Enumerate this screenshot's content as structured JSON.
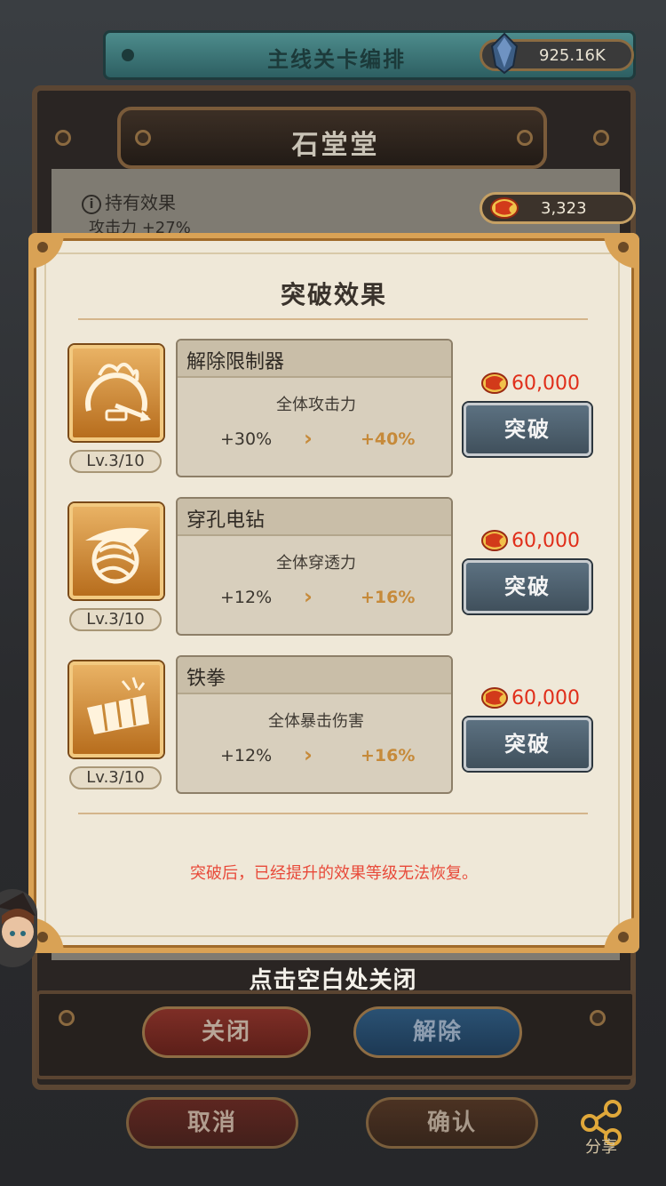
{
  "header": {
    "title": "主线关卡编排",
    "currency_value": "925.16K",
    "currency_icon": "crystal-icon"
  },
  "hero": {
    "name": "石堂堂",
    "hold_effect_label": "持有效果",
    "attack_label": "攻击力 +27%",
    "coin_value": "3,323",
    "coin_icon": "dragon-coin-icon"
  },
  "modal": {
    "title": "突破效果",
    "warning": "突破后，已经提升的效果等级无法恢复。",
    "skills": [
      {
        "name": "解除限制器",
        "level": "Lv.3/10",
        "effect": "全体攻击力",
        "from": "+30%",
        "to": "+40%",
        "cost": "60,000",
        "button": "突破",
        "icon": "speedometer-icon"
      },
      {
        "name": "穿孔电钻",
        "level": "Lv.3/10",
        "effect": "全体穿透力",
        "from": "+12%",
        "to": "+16%",
        "cost": "60,000",
        "button": "突破",
        "icon": "drill-icon"
      },
      {
        "name": "铁拳",
        "level": "Lv.3/10",
        "effect": "全体暴击伤害",
        "from": "+12%",
        "to": "+16%",
        "cost": "60,000",
        "button": "突破",
        "icon": "fist-icon"
      }
    ]
  },
  "footer": {
    "close_hint": "点击空白处关闭",
    "close_label": "关闭",
    "release_label": "解除",
    "cancel_label": "取消",
    "confirm_label": "确认",
    "share_label": "分享"
  },
  "colors": {
    "accent_gold": "#d9a255",
    "cost_red": "#e02e1a",
    "warning_red": "#e84a3a",
    "increase_orange": "#c68a3a",
    "button_blue": "#4c5e6c"
  }
}
